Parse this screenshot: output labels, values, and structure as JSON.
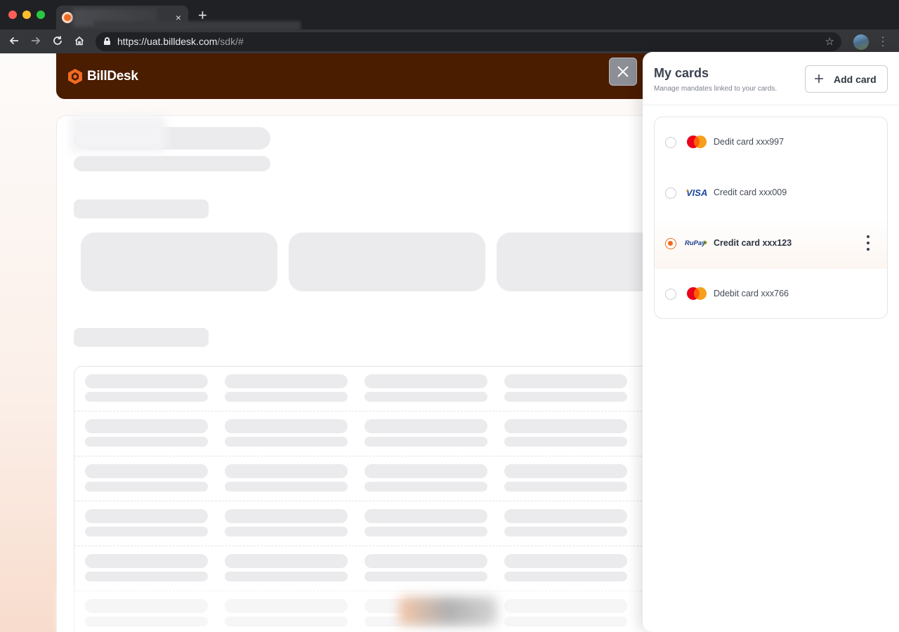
{
  "browser": {
    "tab_close": "×",
    "new_tab": "+",
    "url_main": "https://uat.billdesk.com",
    "url_path": "/sdk/#",
    "icons": [
      "back-icon",
      "forward-icon",
      "reload-icon",
      "home-icon",
      "lock-icon",
      "star-icon",
      "profile-avatar",
      "menu-icon"
    ]
  },
  "brand": {
    "name": "BillDesk",
    "color": "#4a1c00",
    "accent": "#f06b21"
  },
  "overlay": {
    "close_label": "×"
  },
  "panel": {
    "title": "My cards",
    "subtitle": "Manage mandates linked to your cards.",
    "add_label": "Add card",
    "cards": [
      {
        "label": "Dedit card xxx997",
        "brand": "mastercard",
        "selected": false
      },
      {
        "label": "Credit card xxx009",
        "brand": "visa",
        "selected": false
      },
      {
        "label": "Credit card xxx123",
        "brand": "rupay",
        "selected": true
      },
      {
        "label": "Ddebit card xxx766",
        "brand": "mastercard",
        "selected": false
      }
    ],
    "visa_text": "VISA",
    "rupay_text": "RuPay"
  }
}
